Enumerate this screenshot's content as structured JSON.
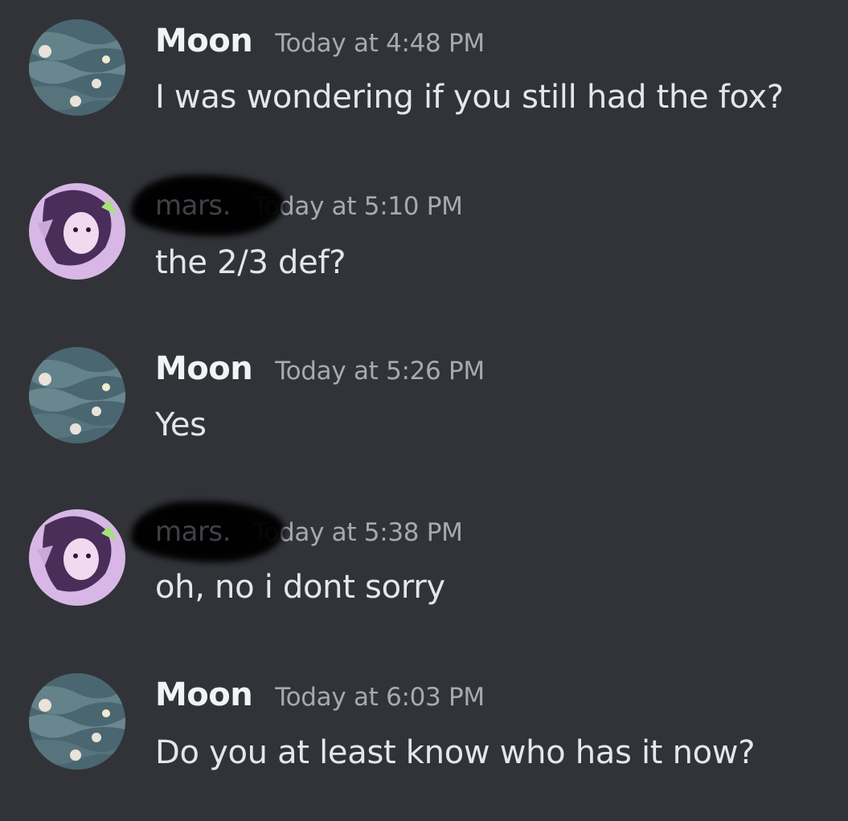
{
  "messages": [
    {
      "author": "Moon",
      "time": "Today at 4:48 PM",
      "text": "I was wondering if you still had the fox?",
      "avatar": "water-flowers-avatar",
      "redacted": false
    },
    {
      "author": "mars.",
      "time": "Today at 5:10 PM",
      "text": "the 2/3 def?",
      "avatar": "anime-girl-avatar",
      "redacted": true
    },
    {
      "author": "Moon",
      "time": "Today at 5:26 PM",
      "text": "Yes",
      "avatar": "water-flowers-avatar",
      "redacted": false
    },
    {
      "author": "mars.",
      "time": "Today at 5:38 PM",
      "text": "oh, no i dont sorry",
      "avatar": "anime-girl-avatar",
      "redacted": true
    },
    {
      "author": "Moon",
      "time": "Today at 6:03 PM",
      "text": "Do you at least know who has it now?",
      "avatar": "water-flowers-avatar",
      "redacted": false
    }
  ],
  "colors": {
    "background": "#313338",
    "author": "#f2f3f5",
    "timestamp": "#a6a9b1",
    "message_text": "#e4e6ea",
    "avatar_purple": "#c9a0dc",
    "avatar_water": "#4a6670"
  }
}
